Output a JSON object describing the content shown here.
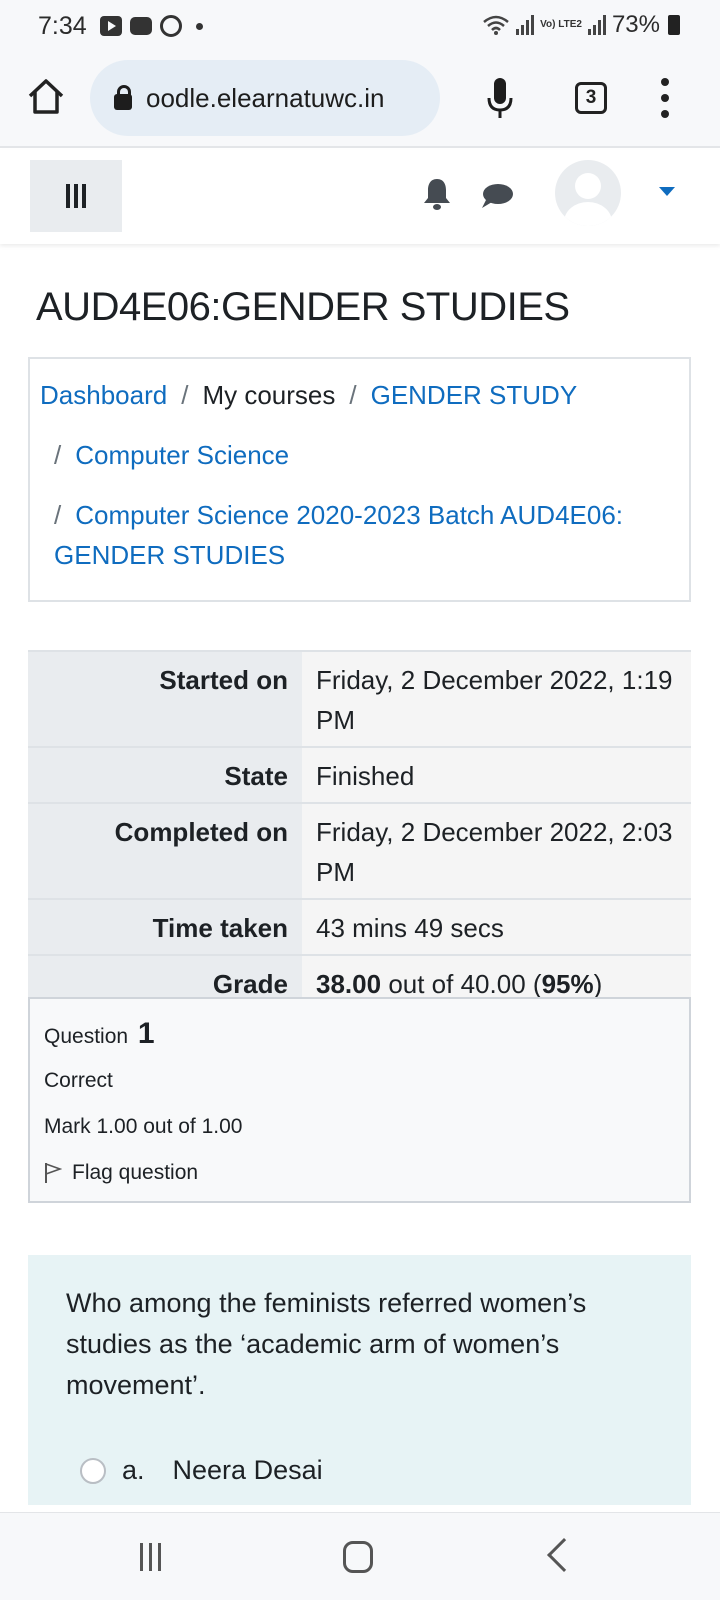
{
  "status_bar": {
    "time": "7:34",
    "network_label": "Vo) LTE2",
    "battery": "73%"
  },
  "browser": {
    "url": "oodle.elearnatuwc.in",
    "tab_count": "3"
  },
  "course": {
    "title": "AUD4E06:GENDER STUDIES"
  },
  "breadcrumb": {
    "dashboard": "Dashboard",
    "my_courses": "My courses",
    "gender_study": "GENDER STUDY",
    "computer_science": "Computer Science",
    "batch": "Computer Science 2020-2023 Batch AUD4E06: GENDER STUDIES",
    "separator": "/"
  },
  "summary": {
    "rows": [
      {
        "label": "Started on",
        "value": "Friday, 2 December 2022, 1:19 PM"
      },
      {
        "label": "State",
        "value": "Finished"
      },
      {
        "label": "Completed on",
        "value": "Friday, 2 December 2022, 2:03 PM"
      },
      {
        "label": "Time taken",
        "value": "43 mins 49 secs"
      }
    ],
    "grade_label": "Grade",
    "grade_score": "38.00",
    "grade_outof": "out of 40.00",
    "grade_pct_open": "(",
    "grade_pct": "95%",
    "grade_pct_close": ")"
  },
  "question": {
    "label": "Question",
    "number": "1",
    "state": "Correct",
    "mark": "Mark 1.00 out of 1.00",
    "flag_label": "Flag question",
    "text": "Who among the feminists referred women’s studies as the ‘academic arm of women’s movement’.",
    "answers": [
      {
        "letter": "a.",
        "text": "Neera Desai"
      }
    ]
  },
  "colors": {
    "link": "#0f6cbf",
    "question_bg": "#e7f3f5"
  }
}
